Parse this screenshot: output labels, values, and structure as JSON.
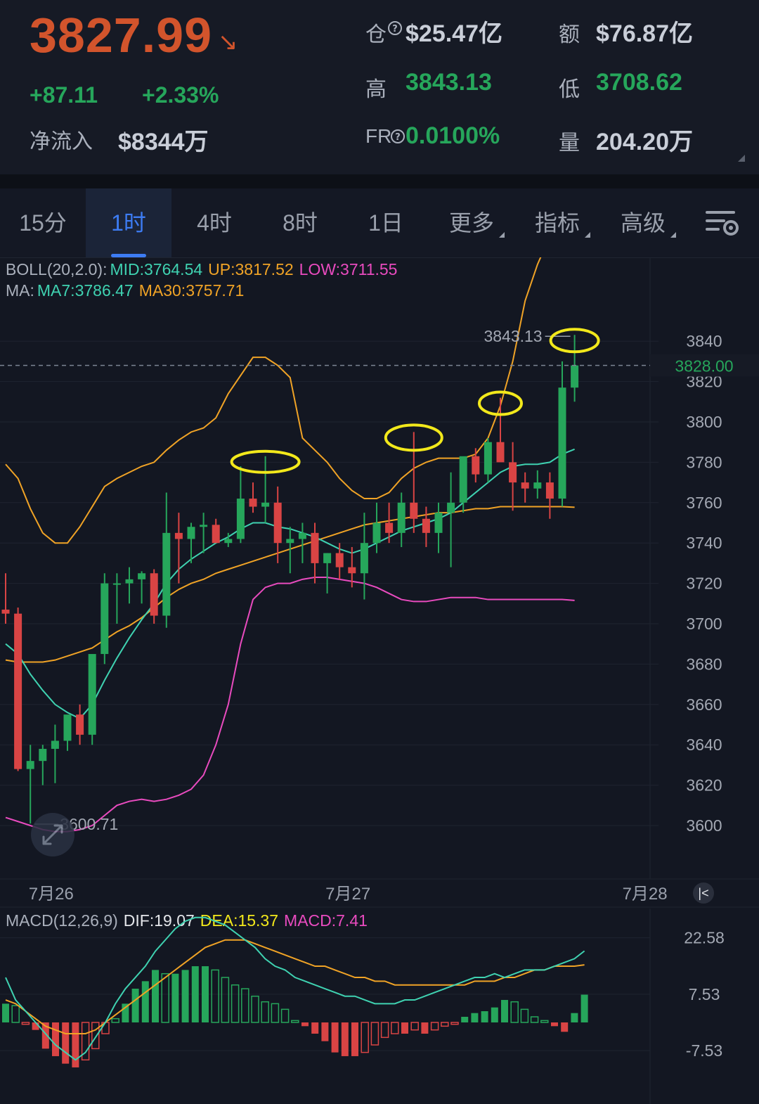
{
  "header": {
    "price": "3827.99",
    "change_abs": "+87.11",
    "change_pct": "+2.33%",
    "netflow_label": "净流入",
    "netflow_value": "$8344万",
    "oi_label": "仓",
    "oi_value": "$25.47亿",
    "turnover_label": "额",
    "turnover_value": "$76.87亿",
    "high_label": "高",
    "high_value": "3843.13",
    "low_label": "低",
    "low_value": "3708.62",
    "fr_label": "FR",
    "fr_value": "0.0100%",
    "volume_label": "量",
    "volume_value": "204.20万"
  },
  "tabs": [
    "15分",
    "1时",
    "4时",
    "8时",
    "1日",
    "更多",
    "指标",
    "高级"
  ],
  "active_tab": "1时",
  "indicators": {
    "boll_name": "BOLL(20,2.0):",
    "boll_mid": "MID:3764.54",
    "boll_up": "UP:3817.52",
    "boll_low": "LOW:3711.55",
    "ma_name": "MA:",
    "ma7": "MA7:3786.47",
    "ma30": "MA30:3757.71",
    "macd_name": "MACD(12,26,9)",
    "dif": "DIF:19.07",
    "dea": "DEA:15.37",
    "macd": "MACD:7.41"
  },
  "colors": {
    "up": "#26a65b",
    "down": "#d94444",
    "price": "#d2542c",
    "boll": "#f0a326",
    "boll_low": "#e94bbf",
    "ma7": "#3fd2b1",
    "dif": "#3fd2b1",
    "dea": "#f0a326",
    "macd_label": "#e94bbf",
    "highlight": "#f2e81b"
  },
  "chart_data": [
    {
      "type": "candlestick",
      "y_ticks": [
        3600,
        3620,
        3640,
        3660,
        3680,
        3700,
        3720,
        3740,
        3760,
        3780,
        3800,
        3820,
        3840
      ],
      "ylim": [
        3578,
        3860
      ],
      "x_labels": [
        {
          "index": 3,
          "label": "7月26"
        },
        {
          "index": 27,
          "label": "7月27"
        },
        {
          "index": 51,
          "label": "7月28"
        }
      ],
      "current_price": "3828.00",
      "current_price_value": 3828,
      "max_label": "3843.13",
      "max_value": 3843.13,
      "min_label": "3600.71",
      "min_value": 3600.71,
      "candles": [
        {
          "o": 3707,
          "h": 3725,
          "l": 3700,
          "c": 3705
        },
        {
          "o": 3705,
          "h": 3708,
          "l": 3627,
          "c": 3628
        },
        {
          "o": 3628,
          "h": 3640,
          "l": 3601,
          "c": 3632
        },
        {
          "o": 3632,
          "h": 3640,
          "l": 3620,
          "c": 3638
        },
        {
          "o": 3638,
          "h": 3650,
          "l": 3621,
          "c": 3642
        },
        {
          "o": 3642,
          "h": 3652,
          "l": 3637,
          "c": 3655
        },
        {
          "o": 3655,
          "h": 3660,
          "l": 3640,
          "c": 3645
        },
        {
          "o": 3645,
          "h": 3680,
          "l": 3640,
          "c": 3685
        },
        {
          "o": 3685,
          "h": 3725,
          "l": 3680,
          "c": 3720
        },
        {
          "o": 3720,
          "h": 3725,
          "l": 3700,
          "c": 3720
        },
        {
          "o": 3720,
          "h": 3728,
          "l": 3710,
          "c": 3722
        },
        {
          "o": 3722,
          "h": 3726,
          "l": 3710,
          "c": 3725
        },
        {
          "o": 3725,
          "h": 3727,
          "l": 3700,
          "c": 3704
        },
        {
          "o": 3704,
          "h": 3765,
          "l": 3698,
          "c": 3745
        },
        {
          "o": 3745,
          "h": 3755,
          "l": 3720,
          "c": 3742
        },
        {
          "o": 3742,
          "h": 3750,
          "l": 3730,
          "c": 3748
        },
        {
          "o": 3748,
          "h": 3755,
          "l": 3735,
          "c": 3749
        },
        {
          "o": 3749,
          "h": 3752,
          "l": 3740,
          "c": 3740
        },
        {
          "o": 3740,
          "h": 3745,
          "l": 3738,
          "c": 3742
        },
        {
          "o": 3742,
          "h": 3778,
          "l": 3740,
          "c": 3762
        },
        {
          "o": 3762,
          "h": 3770,
          "l": 3755,
          "c": 3758
        },
        {
          "o": 3758,
          "h": 3783,
          "l": 3750,
          "c": 3760
        },
        {
          "o": 3760,
          "h": 3768,
          "l": 3730,
          "c": 3740
        },
        {
          "o": 3740,
          "h": 3748,
          "l": 3725,
          "c": 3742
        },
        {
          "o": 3742,
          "h": 3750,
          "l": 3730,
          "c": 3745
        },
        {
          "o": 3745,
          "h": 3750,
          "l": 3720,
          "c": 3730
        },
        {
          "o": 3730,
          "h": 3735,
          "l": 3715,
          "c": 3735
        },
        {
          "o": 3735,
          "h": 3740,
          "l": 3722,
          "c": 3728
        },
        {
          "o": 3728,
          "h": 3738,
          "l": 3718,
          "c": 3725
        },
        {
          "o": 3725,
          "h": 3755,
          "l": 3712,
          "c": 3740
        },
        {
          "o": 3740,
          "h": 3760,
          "l": 3735,
          "c": 3750
        },
        {
          "o": 3750,
          "h": 3760,
          "l": 3740,
          "c": 3745
        },
        {
          "o": 3745,
          "h": 3765,
          "l": 3738,
          "c": 3760
        },
        {
          "o": 3760,
          "h": 3795,
          "l": 3745,
          "c": 3752
        },
        {
          "o": 3752,
          "h": 3758,
          "l": 3738,
          "c": 3745
        },
        {
          "o": 3745,
          "h": 3760,
          "l": 3735,
          "c": 3755
        },
        {
          "o": 3755,
          "h": 3775,
          "l": 3728,
          "c": 3760
        },
        {
          "o": 3760,
          "h": 3782,
          "l": 3755,
          "c": 3783
        },
        {
          "o": 3783,
          "h": 3787,
          "l": 3770,
          "c": 3774
        },
        {
          "o": 3774,
          "h": 3792,
          "l": 3770,
          "c": 3790
        },
        {
          "o": 3790,
          "h": 3812,
          "l": 3785,
          "c": 3780
        },
        {
          "o": 3780,
          "h": 3790,
          "l": 3756,
          "c": 3770
        },
        {
          "o": 3770,
          "h": 3775,
          "l": 3760,
          "c": 3767
        },
        {
          "o": 3767,
          "h": 3776,
          "l": 3762,
          "c": 3770
        },
        {
          "o": 3770,
          "h": 3775,
          "l": 3752,
          "c": 3762
        },
        {
          "o": 3762,
          "h": 3830,
          "l": 3758,
          "c": 3817
        },
        {
          "o": 3817,
          "h": 3843.13,
          "l": 3810,
          "c": 3828
        }
      ],
      "boll_up": [
        3779,
        3772,
        3757,
        3745,
        3740,
        3740,
        3748,
        3758,
        3768,
        3772,
        3775,
        3778,
        3780,
        3786,
        3791,
        3795,
        3797,
        3802,
        3814,
        3823,
        3832,
        3832,
        3828,
        3822,
        3792,
        3786,
        3780,
        3772,
        3766,
        3762,
        3762,
        3765,
        3772,
        3777,
        3780,
        3782,
        3782,
        3782,
        3784,
        3792,
        3808,
        3830,
        3860,
        3878,
        3892,
        3900,
        3912
      ],
      "ma30": [
        3682,
        3681,
        3681,
        3681,
        3682,
        3684,
        3686,
        3688,
        3692,
        3696,
        3699,
        3703,
        3708,
        3713,
        3717,
        3720,
        3722,
        3725,
        3727,
        3729,
        3731,
        3733,
        3735,
        3737,
        3739,
        3741,
        3743,
        3745,
        3747,
        3749,
        3750,
        3751,
        3752,
        3753,
        3754,
        3755,
        3755,
        3756,
        3757,
        3757,
        3758,
        3758,
        3758,
        3758,
        3758,
        3758,
        3757.71
      ],
      "ma7": [
        3690,
        3685,
        3675,
        3667,
        3660,
        3656,
        3653,
        3660,
        3672,
        3683,
        3693,
        3702,
        3710,
        3720,
        3727,
        3732,
        3736,
        3740,
        3743,
        3747,
        3750,
        3750,
        3748,
        3747,
        3745,
        3743,
        3740,
        3737,
        3735,
        3737,
        3740,
        3743,
        3746,
        3748,
        3750,
        3752,
        3755,
        3760,
        3765,
        3770,
        3775,
        3778,
        3779,
        3779,
        3780,
        3784,
        3786.47
      ],
      "boll_low": [
        3604,
        3602,
        3600,
        3598,
        3597,
        3597,
        3598,
        3600,
        3605,
        3610,
        3612,
        3613,
        3612,
        3613,
        3615,
        3618,
        3625,
        3640,
        3660,
        3690,
        3712,
        3718,
        3720,
        3720,
        3722,
        3723,
        3723,
        3722,
        3721,
        3720,
        3718,
        3715,
        3712,
        3711,
        3711,
        3712,
        3713,
        3713,
        3713,
        3712,
        3712,
        3712,
        3712,
        3712,
        3712,
        3712,
        3711.55
      ]
    },
    {
      "type": "bar",
      "name": "MACD(12,26,9)",
      "y_ticks": [
        22.58,
        7.53,
        -7.53
      ],
      "ylim": [
        -12,
        30
      ],
      "hist": [
        5,
        4.5,
        -0.5,
        -2,
        -7,
        -9,
        -11,
        -12,
        -10,
        -7,
        -3,
        1,
        5,
        9,
        11,
        14,
        13,
        13,
        14,
        15,
        15,
        14,
        12,
        10,
        9,
        7,
        5.5,
        5,
        3.5,
        0.5,
        -1,
        -3,
        -5,
        -8,
        -9,
        -9,
        -8,
        -6,
        -4,
        -3,
        -3,
        -2,
        -3,
        -2,
        -1,
        -0.5,
        1.5,
        2.5,
        3,
        4,
        6,
        5.5,
        3.5,
        1.5,
        0.5,
        -1,
        -2.5,
        2.5,
        7.41
      ],
      "dif": [
        12,
        6,
        3,
        0,
        -3,
        -6,
        -8,
        -10,
        -8,
        -4,
        0,
        5,
        9,
        12,
        15,
        19,
        22,
        25,
        27,
        28,
        28,
        27,
        26,
        24,
        22,
        20,
        17,
        15,
        14,
        12,
        11,
        10,
        9,
        8,
        7,
        7,
        6,
        5,
        5,
        5,
        6,
        6,
        7,
        8,
        9,
        10,
        11,
        12,
        12,
        13,
        12,
        13,
        14,
        14,
        14,
        15,
        16,
        17,
        19.07
      ],
      "dea": [
        6,
        5,
        3,
        1,
        -1,
        -2,
        -3,
        -3,
        -3,
        -2,
        0,
        2,
        4,
        6,
        8,
        10,
        12,
        14,
        16,
        18,
        20,
        21,
        22,
        22,
        22,
        21,
        20,
        19,
        18,
        17,
        16,
        15,
        15,
        14,
        13,
        12,
        12,
        11,
        11,
        10,
        10,
        10,
        10,
        10,
        10,
        10,
        10,
        11,
        11,
        11,
        12,
        12,
        13,
        14,
        14,
        15,
        15,
        15,
        15.37
      ]
    }
  ]
}
